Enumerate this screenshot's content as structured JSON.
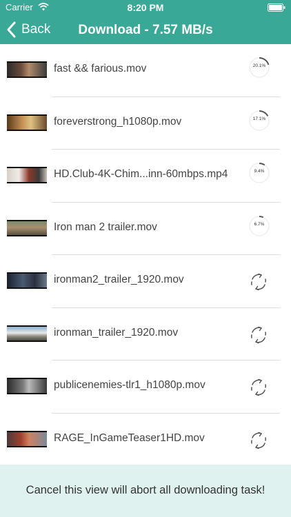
{
  "status_bar": {
    "carrier": "Carrier",
    "time": "8:20 PM"
  },
  "nav": {
    "back_label": "Back",
    "title": "Download - 7.57 MB/s"
  },
  "items": [
    {
      "name": "fast && farious.mov",
      "state": "downloading",
      "progress_label": "20.1%",
      "progress": 0.201
    },
    {
      "name": "foreverstrong_h1080p.mov",
      "state": "downloading",
      "progress_label": "17.1%",
      "progress": 0.171
    },
    {
      "name": "HD.Club-4K-Chim...inn-60mbps.mp4",
      "state": "downloading",
      "progress_label": "9.4%",
      "progress": 0.094
    },
    {
      "name": "Iron man 2 trailer.mov",
      "state": "downloading",
      "progress_label": "6.7%",
      "progress": 0.067
    },
    {
      "name": "ironman2_trailer_1920.mov",
      "state": "waiting",
      "icon": "waiting-refresh-icon"
    },
    {
      "name": "ironman_trailer_1920.mov",
      "state": "waiting",
      "icon": "waiting-refresh-icon"
    },
    {
      "name": "publicenemies-tlr1_h1080p.mov",
      "state": "waiting",
      "icon": "waiting-refresh-icon"
    },
    {
      "name": "RAGE_InGameTeaser1HD.mov",
      "state": "waiting",
      "icon": "waiting-refresh-icon"
    }
  ],
  "footer": {
    "message": "Cancel this view will abort all downloading task!"
  },
  "colors": {
    "header": "#3aa897",
    "footer": "#dff2ef",
    "progress_ring": "#555555"
  }
}
